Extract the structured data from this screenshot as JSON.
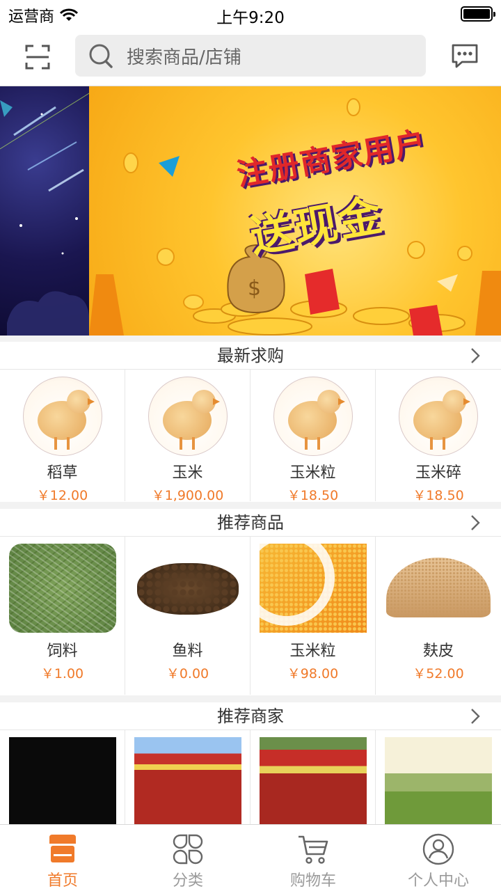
{
  "status_bar": {
    "carrier": "运营商",
    "time": "上午9:20",
    "battery_level": 1.0
  },
  "header": {
    "search_placeholder": "搜索商品/店铺"
  },
  "banner": {
    "title_line1": "注册商家用户",
    "title_line2": "送现金"
  },
  "sections": {
    "latest_purchase": {
      "title": "最新求购",
      "items": [
        {
          "name": "稻草",
          "price": "￥12.00"
        },
        {
          "name": "玉米",
          "price": "￥1,900.00"
        },
        {
          "name": "玉米粒",
          "price": "￥18.50"
        },
        {
          "name": "玉米碎",
          "price": "￥18.50"
        }
      ]
    },
    "recommended_products": {
      "title": "推荐商品",
      "items": [
        {
          "name": "饲料",
          "price": "￥1.00"
        },
        {
          "name": "鱼料",
          "price": "￥0.00"
        },
        {
          "name": "玉米粒",
          "price": "￥98.00"
        },
        {
          "name": "麸皮",
          "price": "￥52.00"
        }
      ]
    },
    "recommended_merchants": {
      "title": "推荐商家"
    }
  },
  "tab_bar": {
    "items": [
      {
        "label": "首页",
        "icon": "home-store-icon",
        "active": true
      },
      {
        "label": "分类",
        "icon": "category-grid-icon",
        "active": false
      },
      {
        "label": "购物车",
        "icon": "cart-icon",
        "active": false
      },
      {
        "label": "个人中心",
        "icon": "profile-icon",
        "active": false
      }
    ]
  },
  "colors": {
    "accent": "#f07a2a",
    "text": "#333333",
    "muted": "#9a9a9a"
  }
}
